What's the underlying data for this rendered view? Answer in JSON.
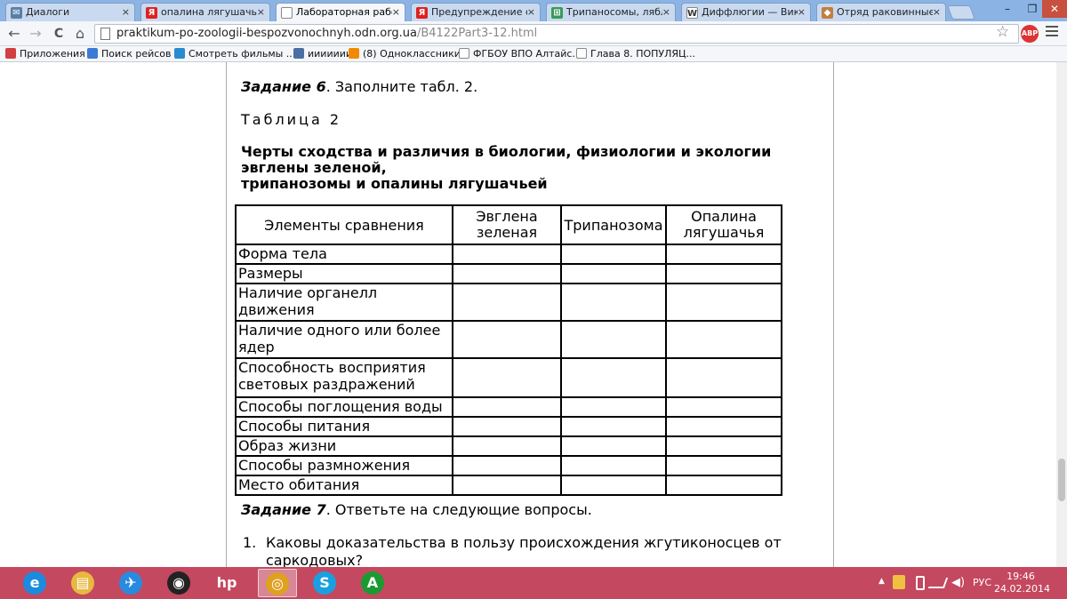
{
  "browser": {
    "tabs": [
      {
        "title": "Диалоги",
        "icon": "vk-icon",
        "color": "#5b7fa6",
        "glyph": "✉"
      },
      {
        "title": "опалина лягушачья с",
        "icon": "yandex-icon",
        "color": "#e02020",
        "glyph": "Я"
      },
      {
        "title": "Лабораторная работа",
        "icon": "page-icon",
        "color": "#ffffff",
        "glyph": ""
      },
      {
        "title": "Предупреждение о п",
        "icon": "yandex-icon",
        "color": "#e02020",
        "glyph": "Я"
      },
      {
        "title": "Трипаносомы, ляблі",
        "icon": "site-icon",
        "color": "#3a9a5a",
        "glyph": "⊞"
      },
      {
        "title": "Диффлюгии — Вики",
        "icon": "wikipedia-icon",
        "color": "#ffffff",
        "glyph": "W"
      },
      {
        "title": "Отряд раковинные ам",
        "icon": "site-icon",
        "color": "#c08040",
        "glyph": "◆"
      }
    ],
    "close_glyph": "×",
    "window": {
      "minimize": "–",
      "restore": "❐",
      "close": "✕"
    },
    "nav": {
      "back": "←",
      "forward": "→",
      "reload": "C",
      "home": "⌂"
    },
    "url": {
      "host": "praktikum-po-zoologii-bespozvonochnyh.odn.org.ua",
      "path": "/B4122Part3-12.html"
    },
    "star": "☆",
    "abp": "ABP",
    "bookmarks": [
      {
        "label": "Приложения",
        "color": "#d04040"
      },
      {
        "label": "Поиск рейсов",
        "color": "#3a7bd5"
      },
      {
        "label": "Смотреть фильмы ...",
        "color": "#2a8ad0"
      },
      {
        "label": "иииииии",
        "color": "#4a6fa5"
      },
      {
        "label": "(8) Одноклассники",
        "color": "#f28a00"
      },
      {
        "label": "ФГБОУ ВПО Алтайс...",
        "color": "#ffffff"
      },
      {
        "label": "Глава 8. ПОПУЛЯЦ...",
        "color": "#ffffff"
      }
    ]
  },
  "content": {
    "task6": {
      "head": "Задание 6",
      "rest": ". Заполните табл. 2."
    },
    "table_label": "Таблица 2",
    "caption": [
      "Черты сходства и различия в биологии, физиологии и экологии",
      "эвглены зеленой,",
      "трипанозомы и опалины лягушачьей"
    ],
    "headers": [
      "Элементы сравнения",
      "Эвглена зеленая",
      "Трипанозома",
      "Опалина лягушачья"
    ],
    "rows": [
      "Форма тела",
      "Размеры",
      "Наличие органелл движения",
      "Наличие одного или более ядер",
      "Способность восприятия световых раздражений",
      "Способы поглощения воды",
      "Способы питания",
      "Образ жизни",
      "Способы размножения",
      "Место обитания"
    ],
    "task7": {
      "head": "Задание 7",
      "rest": ". Ответьте на следующие вопросы."
    },
    "q1_num": "1.",
    "q1_line1": "Каковы доказательства в пользу происхождения жгутиконосцев от",
    "q1_line2": "саркодовых?"
  },
  "taskbar": {
    "apps": [
      {
        "name": "internet-explorer-icon",
        "glyph": "e",
        "color": "#1b8be0"
      },
      {
        "name": "file-explorer-icon",
        "glyph": "▤",
        "color": "#e8b840"
      },
      {
        "name": "rocket-app-icon",
        "glyph": "✈",
        "color": "#2a8ae0"
      },
      {
        "name": "webcam-app-icon",
        "glyph": "◉",
        "color": "#222222"
      },
      {
        "name": "hp-icon",
        "glyph": "hp",
        "color": "#c4485f"
      },
      {
        "name": "chrome-icon",
        "glyph": "◎",
        "color": "#e0a020"
      },
      {
        "name": "skype-icon",
        "glyph": "S",
        "color": "#1aa0e0"
      },
      {
        "name": "green-a-app-icon",
        "glyph": "A",
        "color": "#1a9a30"
      }
    ],
    "tray_arrow": "▲",
    "lang": "РУС",
    "time": "19:46",
    "date": "24.02.2014"
  }
}
